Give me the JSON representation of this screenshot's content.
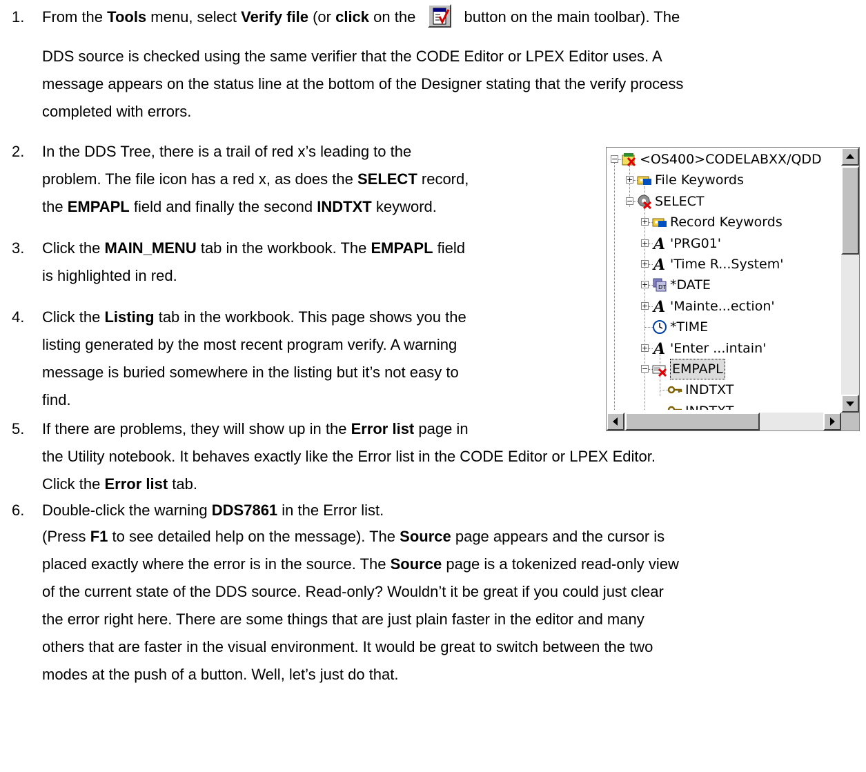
{
  "steps": [
    {
      "num": "1.",
      "lines": [
        [
          {
            "t": "From the "
          },
          {
            "t": "Tools",
            "b": true
          },
          {
            "t": " menu, select "
          },
          {
            "t": "Verify file",
            "b": true
          },
          {
            "t": " (or "
          },
          {
            "t": "click",
            "b": true
          },
          {
            "t": " on the "
          },
          {
            "icon": "verify-button"
          },
          {
            "t": " button on the main toolbar).  The"
          }
        ],
        [
          {
            "t": "DDS source is checked using the same verifier that the CODE Editor or LPEX Editor uses.  A"
          }
        ],
        [
          {
            "t": "message appears on the status line at the bottom of the Designer stating that the verify process"
          }
        ],
        [
          {
            "t": "completed with errors."
          }
        ]
      ]
    },
    {
      "num": "2.",
      "lines": [
        [
          {
            "t": "In the DDS Tree, there is a trail of red x’s leading to the"
          }
        ],
        [
          {
            "t": "problem.  The file icon has a red x, as does the "
          },
          {
            "t": "SELECT",
            "b": true
          },
          {
            "t": " record,"
          }
        ],
        [
          {
            "t": "the "
          },
          {
            "t": "EMPAPL",
            "b": true
          },
          {
            "t": " field and finally the second "
          },
          {
            "t": "INDTXT",
            "b": true
          },
          {
            "t": " keyword."
          }
        ]
      ]
    },
    {
      "num": "3.",
      "lines": [
        [
          {
            "t": "Click the "
          },
          {
            "t": "MAIN_MENU",
            "b": true
          },
          {
            "t": " tab in the workbook.  The "
          },
          {
            "t": "EMPAPL",
            "b": true
          },
          {
            "t": " field"
          }
        ],
        [
          {
            "t": "is highlighted in red."
          }
        ]
      ]
    },
    {
      "num": "4.",
      "lines": [
        [
          {
            "t": "Click the "
          },
          {
            "t": "Listing",
            "b": true
          },
          {
            "t": " tab in the workbook.  This page shows you the"
          }
        ],
        [
          {
            "t": "listing generated by the most recent program verify.  A warning"
          }
        ],
        [
          {
            "t": "message is buried somewhere in the listing but it’s not easy to"
          }
        ],
        [
          {
            "t": "find."
          }
        ]
      ]
    },
    {
      "num": "5.",
      "lines": [
        [
          {
            "t": "If there are problems, they will show up in the "
          },
          {
            "t": "Error list",
            "b": true
          },
          {
            "t": " page in"
          }
        ],
        [
          {
            "t": "the Utility notebook. It behaves exactly like the Error list in the CODE Editor or LPEX Editor."
          }
        ],
        [
          {
            "t": "Click the "
          },
          {
            "t": "Error list",
            "b": true
          },
          {
            "t": " tab."
          }
        ]
      ]
    },
    {
      "num": "6.",
      "lines": [
        [
          {
            "t": "Double-click the warning "
          },
          {
            "t": "DDS7861",
            "b": true
          },
          {
            "t": " in the Error list."
          }
        ],
        [
          {
            "t": "(Press "
          },
          {
            "t": "F1",
            "b": true
          },
          {
            "t": " to see detailed help on the message).  The "
          },
          {
            "t": "Source",
            "b": true
          },
          {
            "t": " page appears and the cursor is"
          }
        ],
        [
          {
            "t": "placed exactly where the error is in the source.  The "
          },
          {
            "t": "Source",
            "b": true
          },
          {
            "t": " page is a tokenized read-only view"
          }
        ],
        [
          {
            "t": "of the current state of the DDS source.  Read-only?  Wouldn’t it be great if you could just clear"
          }
        ],
        [
          {
            "t": "the error right here.  There are some things that are just plain faster in the editor and many"
          }
        ],
        [
          {
            "t": "others that are faster in the visual environment.  It would be great to switch between the two"
          }
        ],
        [
          {
            "t": "modes at the push of a button. Well, let’s just do that."
          }
        ]
      ]
    }
  ],
  "tree": {
    "root_label": "<OS400>CODELABXX/QDD",
    "nodes": [
      {
        "label": "File Keywords",
        "icon": "keywords-icon"
      },
      {
        "label": "SELECT",
        "icon": "record-error-icon"
      },
      {
        "label": "Record Keywords",
        "icon": "keywords-icon"
      },
      {
        "label": "'PRG01'",
        "icon": "text-constant-icon"
      },
      {
        "label": "'Time R...System'",
        "icon": "text-constant-icon"
      },
      {
        "label": "*DATE",
        "icon": "date-icon"
      },
      {
        "label": "'Mainte...ection'",
        "icon": "text-constant-icon"
      },
      {
        "label": "*TIME",
        "icon": "clock-icon"
      },
      {
        "label": "'Enter ...intain'",
        "icon": "text-constant-icon"
      },
      {
        "label": "EMPAPL",
        "icon": "field-error-icon"
      },
      {
        "label": "INDTXT",
        "icon": "key-icon"
      },
      {
        "label": "INDTXT",
        "icon": "key-error-icon"
      }
    ]
  }
}
